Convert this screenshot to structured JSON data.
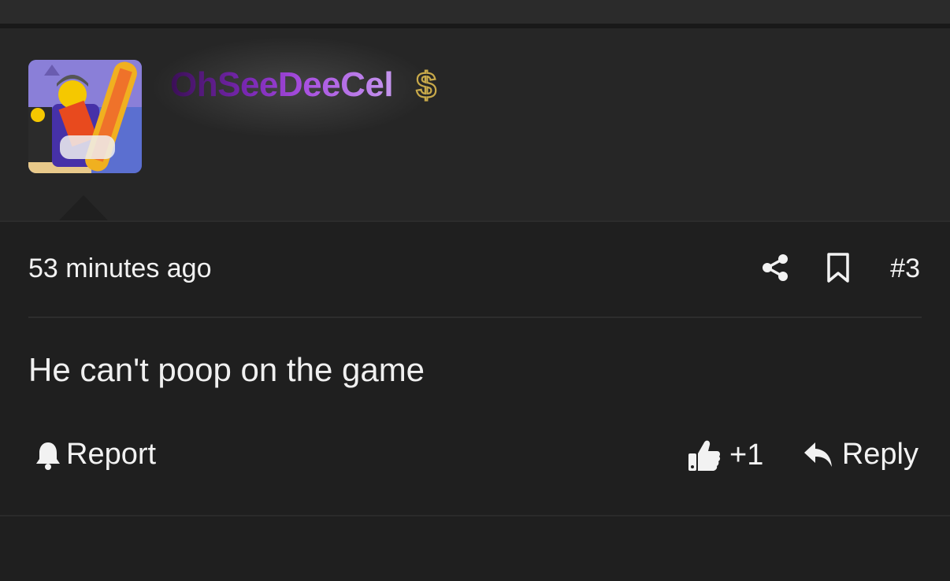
{
  "post": {
    "username": "OhSeeDeeCel",
    "badge_icon": "dollar-sign-icon",
    "timestamp": "53 minutes ago",
    "post_number": "#3",
    "body": "He can't poop on the game"
  },
  "actions": {
    "report_label": "Report",
    "like_count": "+1",
    "reply_label": "Reply"
  },
  "colors": {
    "background": "#1f1f1f",
    "header_background": "#262626",
    "username_gradient_start": "#3a0f55",
    "username_gradient_end": "#c596ee",
    "badge_gold": "#c8a94a"
  }
}
